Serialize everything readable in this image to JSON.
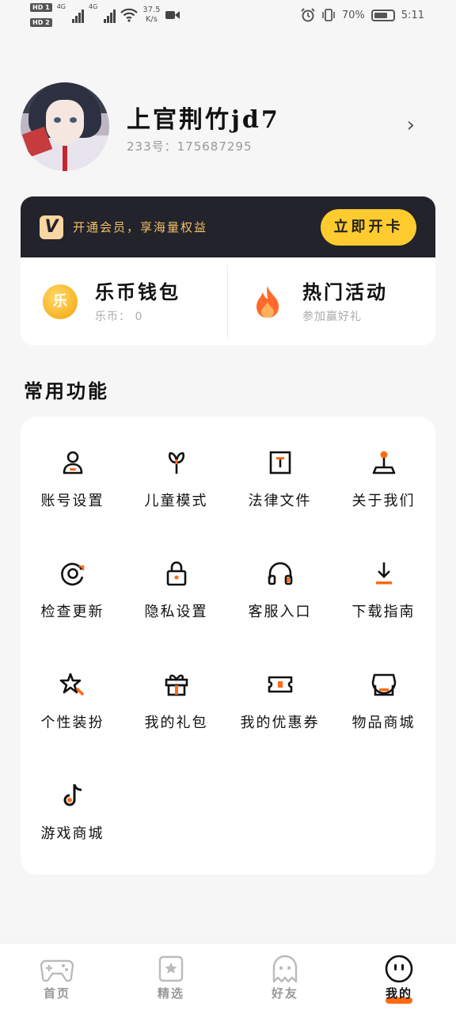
{
  "status_bar": {
    "sim1": "HD 1",
    "sim2": "HD 2",
    "net1": "4G",
    "net2": "4G",
    "speed_value": "37.5",
    "speed_unit": "K/s",
    "battery": "70%",
    "time": "5:11"
  },
  "profile": {
    "name": "上官荆竹jd7",
    "id_text": "233号：175687295"
  },
  "vip": {
    "logo": "V",
    "text": "开通会员，享海量权益",
    "button": "立即开卡"
  },
  "quick": [
    {
      "title": "乐币钱包",
      "sub": "乐币： 0",
      "icon": "coin-icon",
      "icon_text": "乐"
    },
    {
      "title": "热门活动",
      "sub": "参加赢好礼",
      "icon": "fire-icon"
    }
  ],
  "section_title": "常用功能",
  "functions": [
    {
      "label": "账号设置",
      "icon": "account-icon"
    },
    {
      "label": "儿童模式",
      "icon": "kids-icon"
    },
    {
      "label": "法律文件",
      "icon": "legal-icon"
    },
    {
      "label": "关于我们",
      "icon": "about-icon"
    },
    {
      "label": "检查更新",
      "icon": "update-icon"
    },
    {
      "label": "隐私设置",
      "icon": "lock-icon"
    },
    {
      "label": "客服入口",
      "icon": "headset-icon"
    },
    {
      "label": "下载指南",
      "icon": "download-icon"
    },
    {
      "label": "个性装扮",
      "icon": "star-icon"
    },
    {
      "label": "我的礼包",
      "icon": "gift-icon"
    },
    {
      "label": "我的优惠券",
      "icon": "coupon-icon"
    },
    {
      "label": "物品商城",
      "icon": "shop-icon"
    },
    {
      "label": "游戏商城",
      "icon": "tiktok-icon"
    }
  ],
  "nav": [
    {
      "label": "首页",
      "icon": "gamepad-icon"
    },
    {
      "label": "精选",
      "icon": "featured-icon"
    },
    {
      "label": "好友",
      "icon": "ghost-icon"
    },
    {
      "label": "我的",
      "icon": "me-icon",
      "active": true
    }
  ],
  "colors": {
    "accent": "#ff6a13",
    "vip_bg": "#23232b",
    "vip_btn": "#ffcb2e",
    "vip_text": "#f2c06a"
  }
}
